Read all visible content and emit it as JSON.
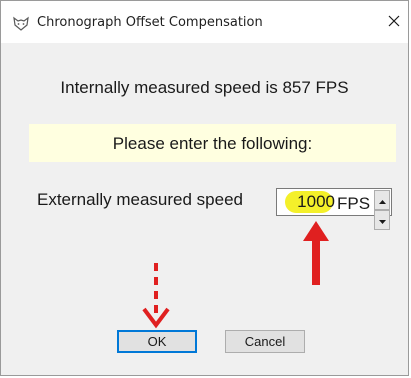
{
  "window": {
    "title": "Chronograph Offset Compensation",
    "app_icon": "fox-head-icon",
    "close_glyph": "✕"
  },
  "main": {
    "measured_text": "Internally measured speed is 857 FPS",
    "notice_text": "Please enter the following:",
    "speed_label": "Externally measured speed",
    "speed_value": "1000",
    "speed_unit": "FPS"
  },
  "buttons": {
    "ok_label": "OK",
    "cancel_label": "Cancel"
  },
  "colors": {
    "annotation_red": "#e02020",
    "highlight_yellow": "#f4f02a",
    "notice_background": "#ffffe0",
    "default_button_border": "#0078d7"
  }
}
